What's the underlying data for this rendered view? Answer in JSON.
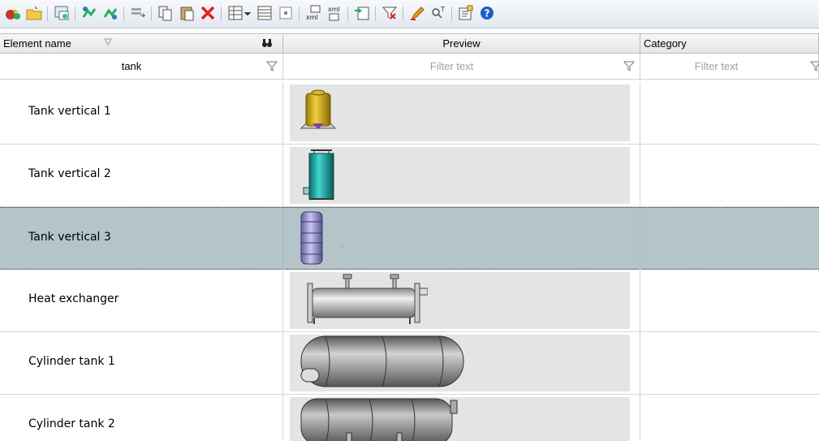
{
  "toolbar": {
    "icons": [
      "new-element-icon",
      "open-folder-icon",
      "image-icon",
      "add-green-icon",
      "export-green-icon",
      "move-icon",
      "copy-icon",
      "paste-icon",
      "delete-icon",
      "view-grid-icon",
      "dropdown-arrow-icon",
      "view-list-icon",
      "view-small-icon",
      "xml-import-icon",
      "xml-export-icon",
      "import-icon",
      "clear-filter-icon",
      "edit-pencil-icon",
      "search-text-icon",
      "properties-icon",
      "help-icon"
    ],
    "colors": {
      "delete": "#e02020",
      "help": "#1a5fc8",
      "folder": "#f2c94c"
    }
  },
  "columns": {
    "name": "Element name",
    "preview": "Preview",
    "category": "Category"
  },
  "filters": {
    "name_value": "tank",
    "preview_placeholder": "Filter text",
    "category_placeholder": "Filter text"
  },
  "rows": [
    {
      "name": "Tank vertical 1",
      "shape": "tank-vertical-gold-icon"
    },
    {
      "name": "Tank vertical 2",
      "shape": "tank-vertical-teal-icon"
    },
    {
      "name": "Tank vertical 3",
      "shape": "tank-vertical-purple-icon",
      "selected": true
    },
    {
      "name": "Heat exchanger",
      "shape": "heat-exchanger-icon"
    },
    {
      "name": "Cylinder tank 1",
      "shape": "cylinder-tank-icon"
    },
    {
      "name": "Cylinder tank 2",
      "shape": "cylinder-tank-legs-icon"
    }
  ]
}
